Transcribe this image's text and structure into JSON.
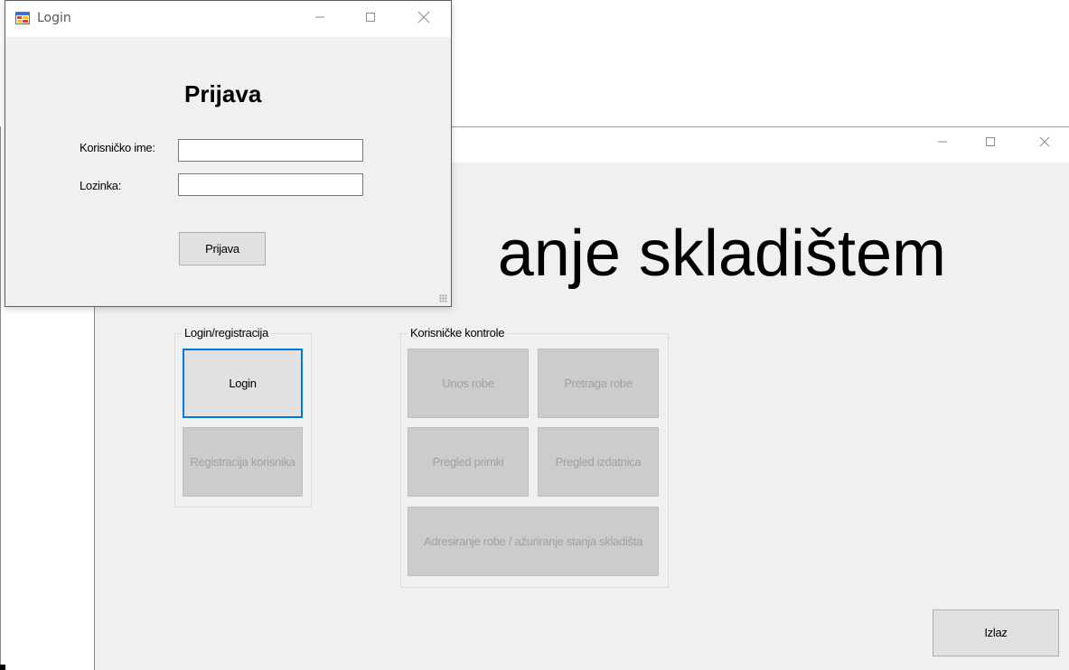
{
  "main_window": {
    "heading": "anje skladištem",
    "login_group": {
      "title": "Login/registracija",
      "login_button": "Login",
      "register_button": "Registracija korisnika"
    },
    "user_group": {
      "title": "Korisničke kontrole",
      "unos_robe": "Unos robe",
      "pretraga_robe": "Pretraga robe",
      "pregled_primki": "Pregled primki",
      "pregled_izdatnica": "Pregled izdatnica",
      "adresiranje": "Adresiranje robe / ažuriranje stanja skladišta"
    },
    "exit_button": "Izlaz"
  },
  "login_window": {
    "title": "Login",
    "heading": "Prijava",
    "username_label": "Korisničko ime:",
    "username_value": "",
    "password_label": "Lozinka:",
    "password_value": "",
    "submit_button": "Prijava"
  },
  "icons": {
    "minimize": "minimize-icon",
    "maximize": "maximize-icon",
    "close": "close-icon",
    "app": "app-form-icon"
  },
  "colors": {
    "window_bg": "#f0f0f0",
    "focus_accent": "#0078d7",
    "disabled_button": "#cccccc",
    "disabled_text": "#a0a0a0"
  }
}
